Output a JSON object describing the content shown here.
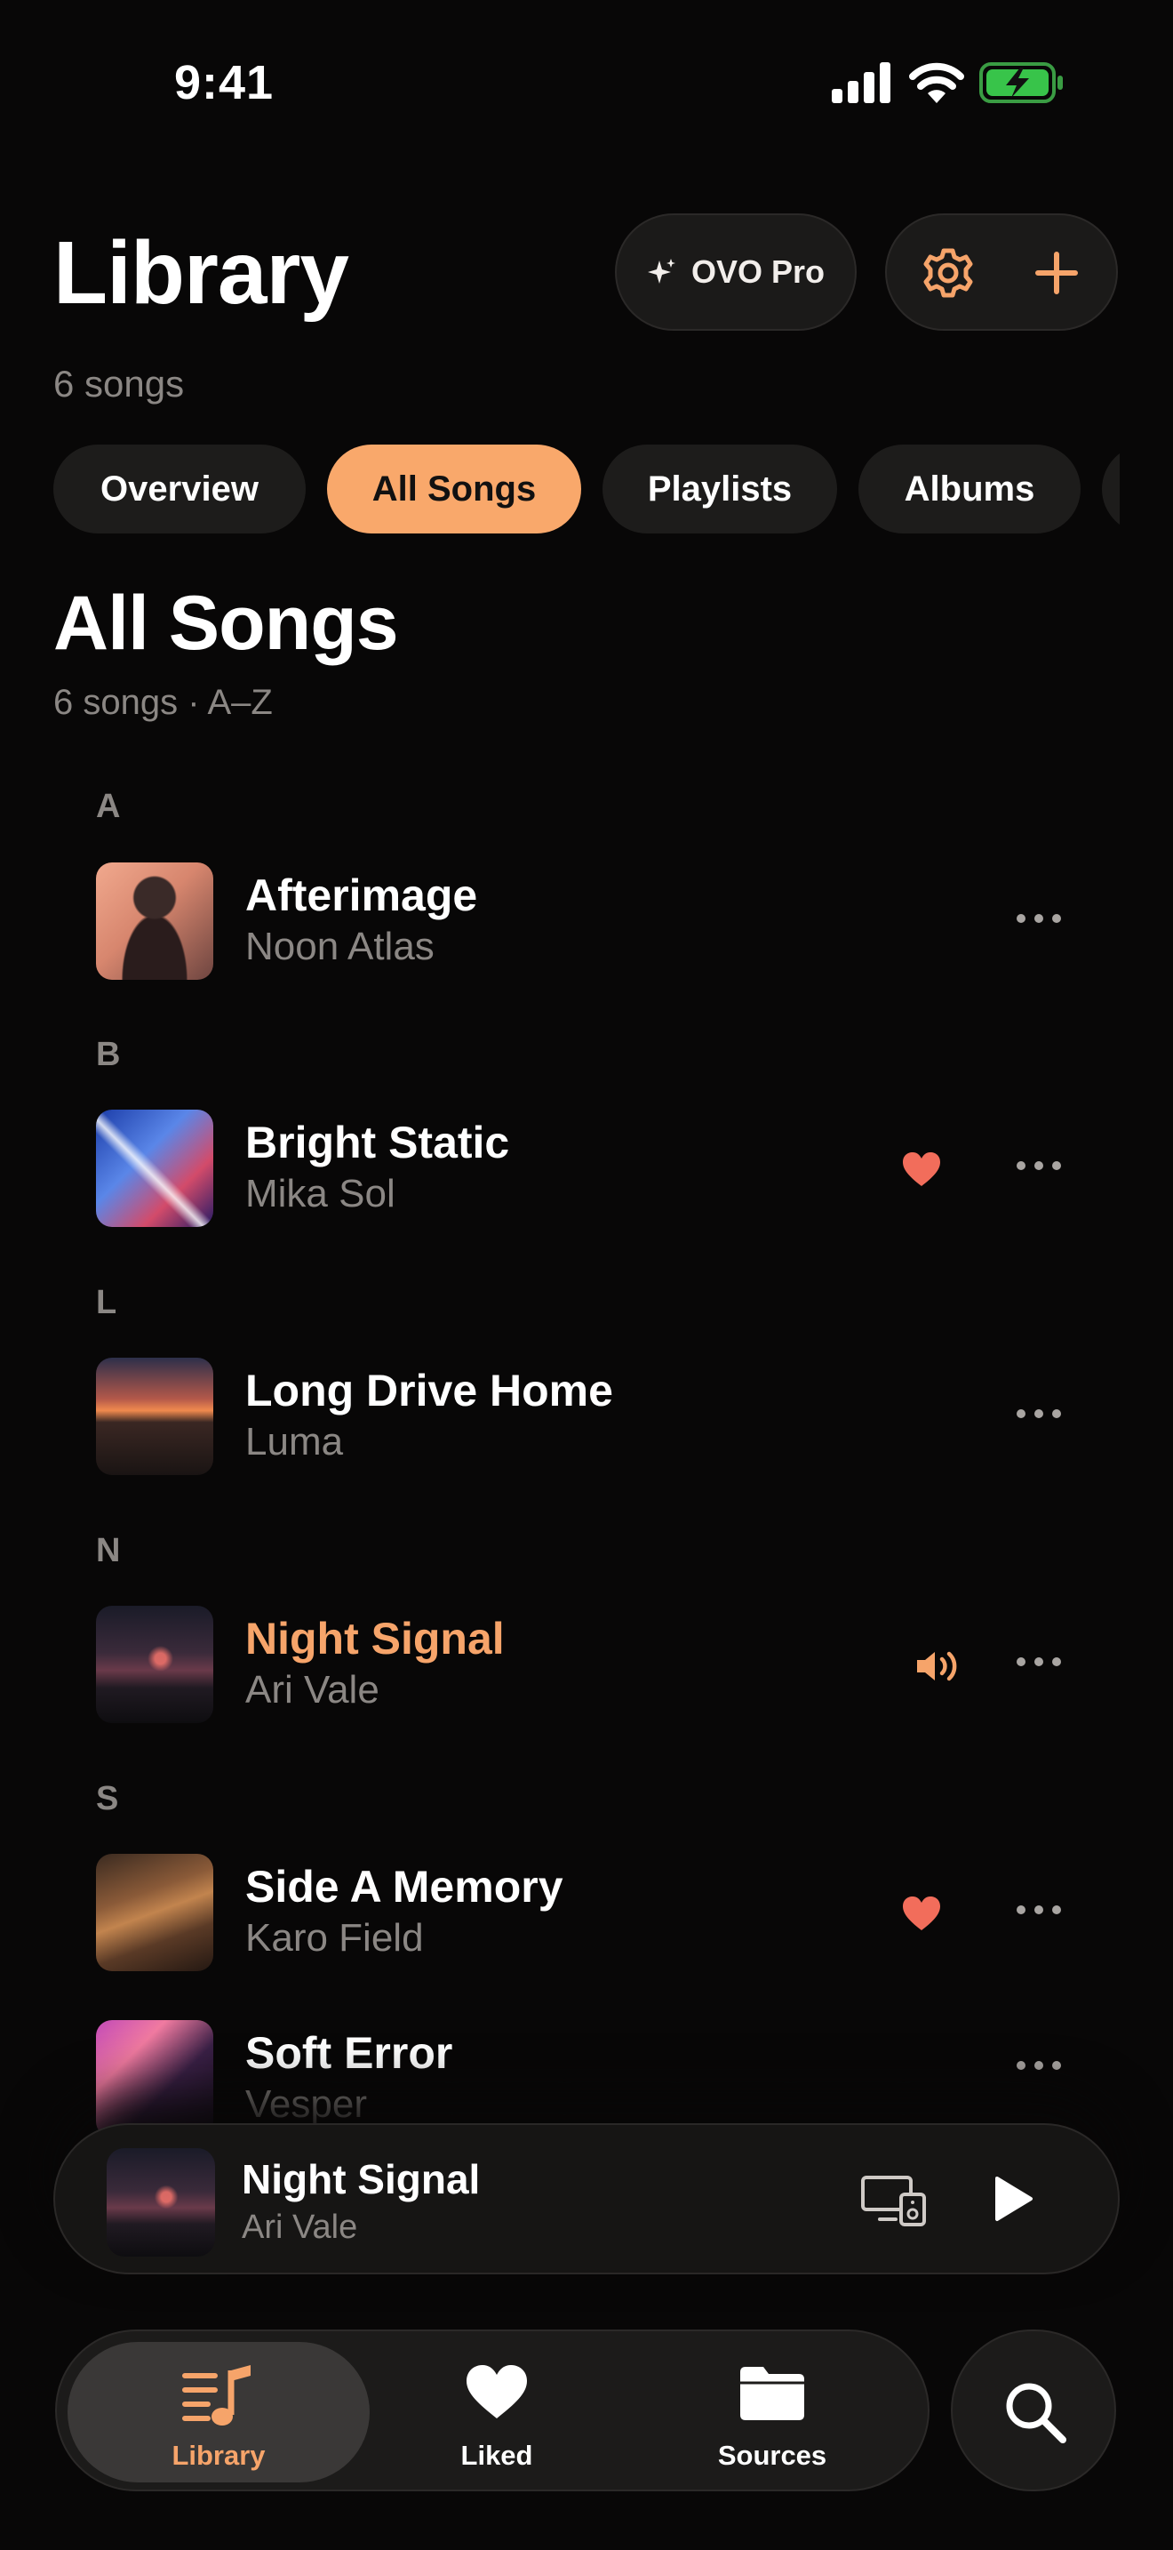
{
  "status_bar": {
    "time": "9:41"
  },
  "header": {
    "title": "Library",
    "subtitle": "6 songs",
    "pro_label": "OVO Pro"
  },
  "tabs": [
    {
      "label": "Overview",
      "active": false
    },
    {
      "label": "All Songs",
      "active": true
    },
    {
      "label": "Playlists",
      "active": false
    },
    {
      "label": "Albums",
      "active": false
    },
    {
      "label": "",
      "active": false
    }
  ],
  "section": {
    "title": "All Songs",
    "subtitle": "6 songs · A–Z"
  },
  "letters": [
    "A",
    "B",
    "L",
    "N",
    "S"
  ],
  "songs": [
    {
      "title": "Afterimage",
      "artist": "Noon Atlas",
      "liked": false,
      "playing": false
    },
    {
      "title": "Bright Static",
      "artist": "Mika Sol",
      "liked": true,
      "playing": false
    },
    {
      "title": "Long Drive Home",
      "artist": "Luma",
      "liked": false,
      "playing": false
    },
    {
      "title": "Night Signal",
      "artist": "Ari Vale",
      "liked": false,
      "playing": true
    },
    {
      "title": "Side A Memory",
      "artist": "Karo Field",
      "liked": true,
      "playing": false
    },
    {
      "title": "Soft Error",
      "artist": "Vesper",
      "liked": false,
      "playing": false
    }
  ],
  "now_playing": {
    "title": "Night Signal",
    "artist": "Ari Vale"
  },
  "tabbar": [
    {
      "label": "Library",
      "icon": "library-icon",
      "active": true
    },
    {
      "label": "Liked",
      "icon": "heart-icon",
      "active": false
    },
    {
      "label": "Sources",
      "icon": "folder-icon",
      "active": false
    }
  ],
  "colors": {
    "accent": "#f9a86b",
    "background": "#080707",
    "heart": "#f26d5b"
  }
}
